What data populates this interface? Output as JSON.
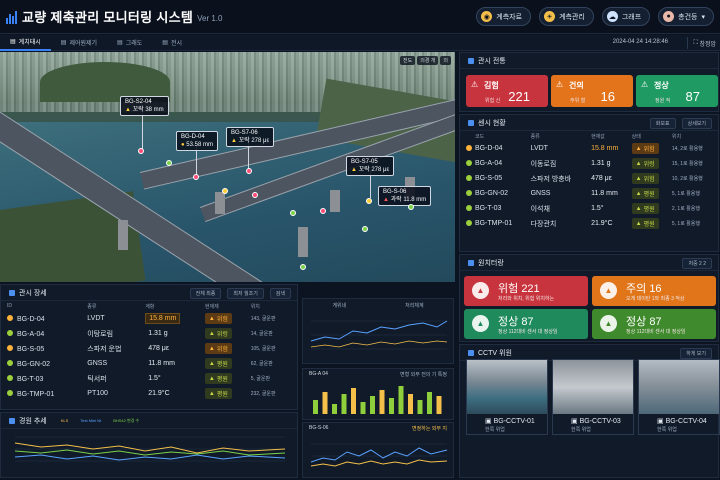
{
  "header": {
    "title": "교량 제축관리 모니터링 시스템",
    "version": "Ver 1.0",
    "buttons": [
      {
        "label": "계측자료",
        "icon": "gauge-icon",
        "color": "#f5c04a"
      },
      {
        "label": "계측관리",
        "icon": "sun-icon",
        "color": "#f5c04a"
      },
      {
        "label": "그래프",
        "icon": "cloud-icon",
        "color": "#cfe3ff"
      },
      {
        "label": "총건등",
        "icon": "user-icon",
        "color": "#e9b8a8"
      }
    ]
  },
  "subnav": {
    "tabs": [
      {
        "label": "계치태시"
      },
      {
        "label": "제어원제기"
      },
      {
        "label": "그래도"
      },
      {
        "label": "전시"
      }
    ],
    "datetime": "2024-04 24 14:28:46",
    "fullscreen": "창정암"
  },
  "scene": {
    "controls": [
      "전도",
      "의경 개",
      "의"
    ],
    "tags": [
      {
        "id": "BG-S2-04",
        "status": "꼬락",
        "value": "38 mm"
      },
      {
        "id": "BG-D-04",
        "status": "",
        "value": "53.58 mm"
      },
      {
        "id": "BG-S7-06",
        "status": "꼬락",
        "value": "278 με"
      },
      {
        "id": "BG-S7-05",
        "status": "꼬락",
        "value": "278 με"
      },
      {
        "id": "BG-S-06",
        "status": "과락",
        "value": "11.8 mm"
      }
    ]
  },
  "status_summary": {
    "title": "관시 전통",
    "cards": [
      {
        "label": "김험",
        "sub": "위험 신",
        "value": "221",
        "color": "#c8343d"
      },
      {
        "label": "건의",
        "sub": "주위 철",
        "value": "16",
        "color": "#e3741c"
      },
      {
        "label": "정상",
        "sub": "정원 적",
        "value": "87",
        "color": "#1f9a63"
      }
    ]
  },
  "sensor_status": {
    "title": "센시 현황",
    "buttons": [
      "화보표",
      "상세보기"
    ],
    "headers": [
      "코드",
      "종류",
      "현재값",
      "상태",
      "위치"
    ],
    "rows": [
      {
        "code": "BG-D-04",
        "type": "LVDT",
        "value": "15.8 mm",
        "value_color": "#ffb23c",
        "state": "위험",
        "state_kind": "warn",
        "loc": "14, 2로 활용행"
      },
      {
        "code": "BG-A-04",
        "type": "이동로짐",
        "value": "1.31 g",
        "value_color": "#e6edf5",
        "state": "위렁",
        "state_kind": "ok",
        "loc": "15, 1로 활용행"
      },
      {
        "code": "BG-S-05",
        "type": "스파저 방충바",
        "value": "478 με",
        "value_color": "#e6edf5",
        "state": "위험",
        "state_kind": "ok",
        "loc": "10, 2로 활용행"
      },
      {
        "code": "BG-GN-02",
        "type": "GNSS",
        "value": "11.8 mm",
        "value_color": "#e6edf5",
        "state": "평원",
        "state_kind": "ok",
        "loc": "5, 1로 활용행"
      },
      {
        "code": "BG-T-03",
        "type": "이석채",
        "value": "1.5°",
        "value_color": "#e6edf5",
        "state": "평원",
        "state_kind": "ok",
        "loc": "2, 1로 활용행"
      },
      {
        "code": "BG-TMP-01",
        "type": "다장관치",
        "value": "21.9°C",
        "value_color": "#e6edf5",
        "state": "평원",
        "state_kind": "ok",
        "loc": "5, 1로 활용행"
      }
    ]
  },
  "alert_status": {
    "title": "원치터랑",
    "button": "처중 2 2",
    "cards": [
      {
        "label": "위험",
        "value": "221",
        "sub": "처리와 위치, 위험 위치하는",
        "color": "#c8343d"
      },
      {
        "label": "주의",
        "value": "16",
        "sub": "오게 데이탄 1와 최종 3 적상",
        "color": "#e0751a"
      },
      {
        "label": "정상",
        "value": "87",
        "sub": "정상 112대비 센서 대 정상임",
        "color": "#1f8a5c"
      },
      {
        "label": "정상",
        "value": "87",
        "sub": "정상 112대비 센서 대 정상임",
        "color": "#3f8a2c"
      }
    ]
  },
  "cctv": {
    "title": "CCTV 위원",
    "button": "하게 보기",
    "cams": [
      {
        "name": "BG-CCTV-01",
        "sub": "한쪽 위업"
      },
      {
        "name": "BG-CCTV-03",
        "sub": "한쪽 위업"
      },
      {
        "name": "BG-CCTV-04",
        "sub": "한쪽 위업"
      }
    ]
  },
  "sensor_list": {
    "title": "관시 장세",
    "buttons": [
      "전체 최종",
      "최저 월조기",
      "검색"
    ],
    "headers": [
      "ID",
      "종류",
      "계항",
      "현재재",
      "위치"
    ],
    "rows": [
      {
        "id": "BG-D-04",
        "type": "LVDT",
        "value": "15.8 mm",
        "value_color": "#ffb23c",
        "state": "위험",
        "state_kind": "warn",
        "loc": "143, 굴운판"
      },
      {
        "id": "BG-A-04",
        "type": "이탕로림",
        "value": "1.31 g",
        "value_color": "#e6edf5",
        "state": "위렁",
        "state_kind": "ok",
        "loc": "14, 굴운판"
      },
      {
        "id": "BG-S-05",
        "type": "스파저 운법",
        "value": "478 με",
        "value_color": "#e6edf5",
        "state": "위험",
        "state_kind": "warn",
        "loc": "105, 굴운판"
      },
      {
        "id": "BG-GN-02",
        "type": "GNSS",
        "value": "11.8 mm",
        "value_color": "#e6edf5",
        "state": "평원",
        "state_kind": "ok",
        "loc": "62, 굴운판"
      },
      {
        "id": "BG-T-03",
        "type": "틱서퍼",
        "value": "1.5°",
        "value_color": "#e6edf5",
        "state": "평원",
        "state_kind": "ok",
        "loc": "5, 굴운판"
      },
      {
        "id": "BG-TMP-01",
        "type": "PT100",
        "value": "21.9°C",
        "value_color": "#e6edf5",
        "state": "평원",
        "state_kind": "ok",
        "loc": "232, 굴운판"
      }
    ]
  },
  "trend_panel": {
    "title": "경원 추세",
    "legend": [
      "KLS",
      "Test Mini Nt",
      "BHS42 변경 수"
    ]
  },
  "mini_charts": {
    "c1": {
      "head1": "게위네",
      "head2": "처리체계"
    },
    "c2": {
      "title": "BG-A 04",
      "legend": "변형 외부 전의 기 특정"
    },
    "c3": {
      "title": "BG-S-06",
      "legend": "변정하는 외부 지"
    }
  }
}
